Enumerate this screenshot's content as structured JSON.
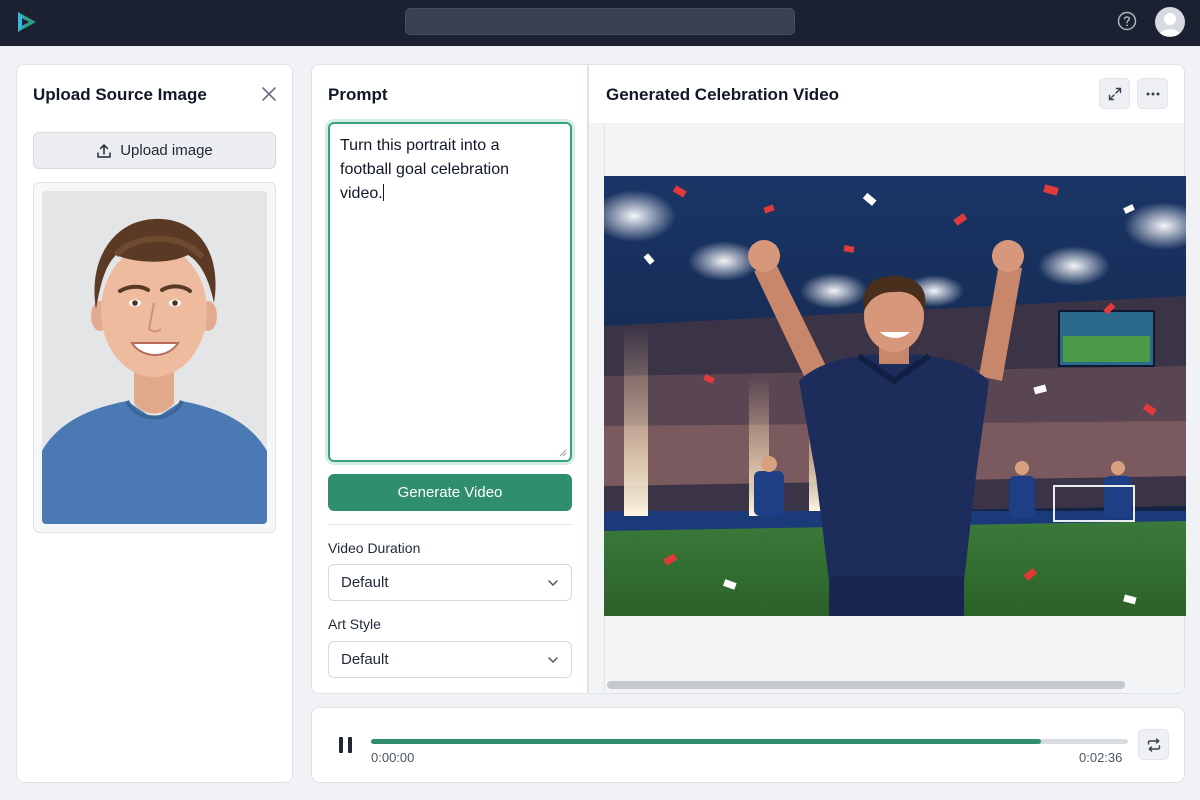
{
  "topbar": {
    "logo_icon": "play-logo-icon",
    "search_placeholder": "",
    "help_icon": "help-circle-icon",
    "avatar_icon": "user-avatar-icon"
  },
  "upload_panel": {
    "title": "Upload Source Image",
    "close_icon": "close-icon",
    "upload_button_label": "Upload image",
    "upload_icon": "upload-icon"
  },
  "prompt_panel": {
    "title": "Prompt",
    "prompt_value": "Turn this portrait into a\nfootball goal celebration\nvideo.",
    "generate_button_label": "Generate Video",
    "duration_label": "Video Duration",
    "duration_value": "Default",
    "style_label": "Art Style",
    "style_value": "Default"
  },
  "video_panel": {
    "title": "Generated Celebration Video",
    "expand_icon": "expand-icon",
    "more_icon": "more-horizontal-icon"
  },
  "player": {
    "pause_icon": "pause-icon",
    "loop_icon": "repeat-icon",
    "current_time": "0:00:00",
    "total_time": "0:02:36",
    "progress_percent": 88.5
  },
  "colors": {
    "accent": "#2f8f6c",
    "topbar": "#1b2130",
    "background": "#f1f2f5"
  }
}
